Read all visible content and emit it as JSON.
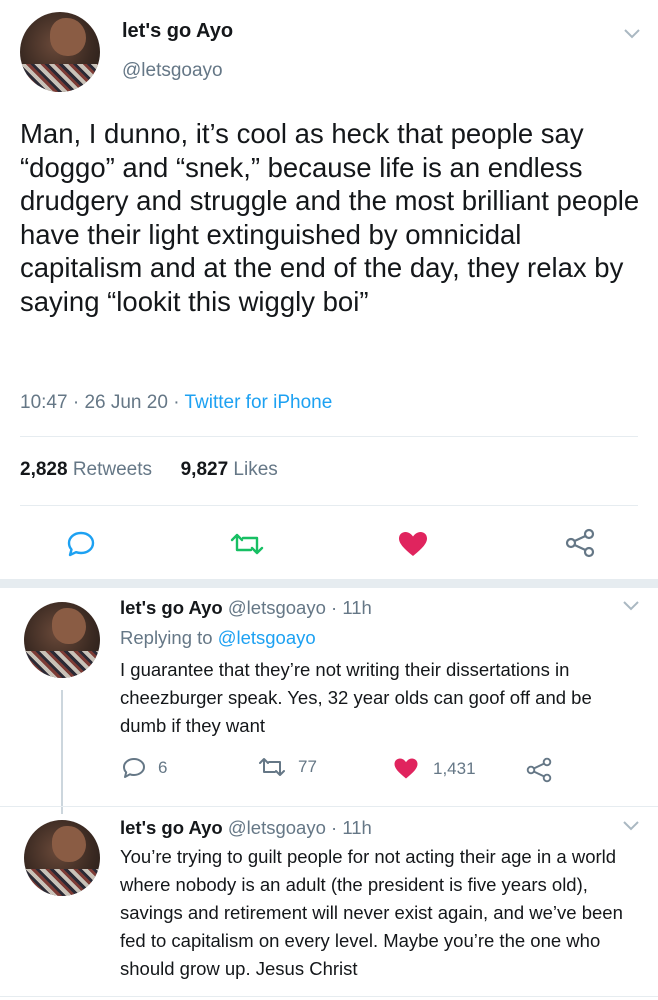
{
  "main_tweet": {
    "display_name": "let's go Ayo",
    "handle": "@letsgoayo",
    "text": "Man, I dunno, it’s cool as heck that people say “doggo” and “snek,” because life is an endless drudgery and struggle and the most brilliant people have their light extinguished by omnicidal capitalism and at the end of the day, they relax by saying “lookit this wiggly boi”",
    "time": "10:47",
    "date": "26 Jun 20",
    "sep": "·",
    "source": "Twitter for iPhone",
    "retweets_count": "2,828",
    "retweets_label": "Retweets",
    "likes_count": "9,827",
    "likes_label": "Likes"
  },
  "replies": [
    {
      "display_name": "let's go Ayo",
      "handle": "@letsgoayo",
      "age": "11h",
      "replying_prefix": "Replying to",
      "replying_to": "@letsgoayo",
      "text": "I guarantee that they’re not writing their dissertations in cheezburger speak. Yes, 32 year olds can goof off and be dumb if they want",
      "reply_count": "6",
      "retweet_count": "77",
      "like_count": "1,431"
    },
    {
      "display_name": "let's go Ayo",
      "handle": "@letsgoayo",
      "age": "11h",
      "text": "You’re trying to guilt people for not acting their age in a world where nobody is an adult (the president is five years old), savings and retirement will never exist again, and we’ve been fed to capitalism on every level. Maybe you’re the one who should grow up. Jesus Christ"
    }
  ],
  "icons": {
    "reply": "reply-icon",
    "retweet": "retweet-icon",
    "like": "heart-icon",
    "share": "share-icon",
    "menu": "chevron-down-icon"
  },
  "colors": {
    "text": "#14171a",
    "muted": "#657786",
    "link": "#1da1f2",
    "retweet_green": "#17bf63",
    "like_red": "#e0245e",
    "icon_blue": "#1da1f2"
  }
}
